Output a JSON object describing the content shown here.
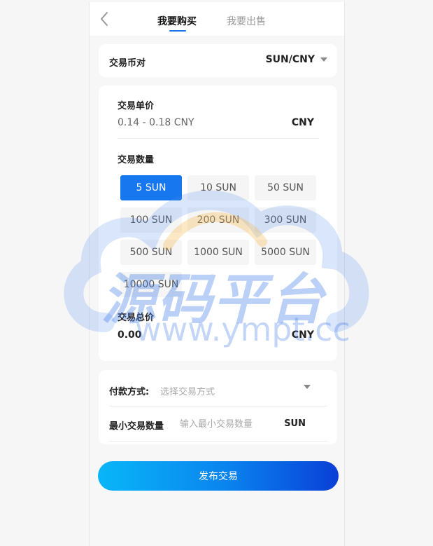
{
  "header": {
    "tabs": [
      {
        "label": "我要购买",
        "active": true
      },
      {
        "label": "我要出售",
        "active": false
      }
    ]
  },
  "pair": {
    "label": "交易币对",
    "value": "SUN/CNY"
  },
  "price": {
    "title": "交易单价",
    "range": "0.14 - 0.18 CNY",
    "unit": "CNY"
  },
  "quantity": {
    "title": "交易数量",
    "options": [
      "5 SUN",
      "10 SUN",
      "50 SUN",
      "100 SUN",
      "200 SUN",
      "300 SUN",
      "500 SUN",
      "1000 SUN",
      "5000 SUN",
      "10000 SUN"
    ],
    "selected_index": 0
  },
  "total": {
    "title": "交易总价",
    "value": "0.00",
    "unit": "CNY"
  },
  "payment": {
    "label": "付款方式:",
    "placeholder": "选择交易方式"
  },
  "min_qty": {
    "label": "最小交易数量",
    "placeholder": "输入最小交易数量",
    "unit": "SUN"
  },
  "publish_label": "发布交易",
  "watermark": {
    "text": "源码平台",
    "url": "www.ympt.cc"
  },
  "colors": {
    "accent": "#1677ee",
    "button_gradient_start": "#09b6f8",
    "button_gradient_end": "#0a3fd6"
  }
}
